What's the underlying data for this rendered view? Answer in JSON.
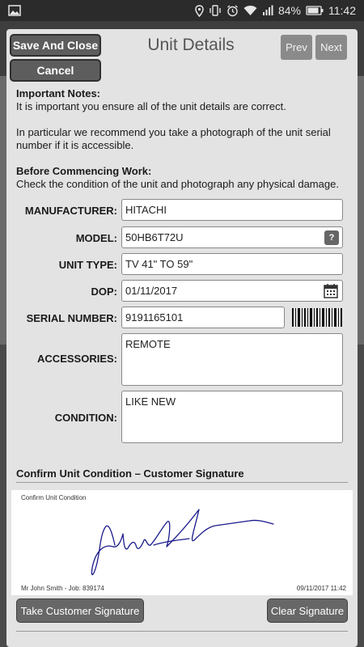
{
  "status_bar": {
    "battery_percent": "84%",
    "time": "11:42",
    "icons": [
      "image-icon",
      "location-icon",
      "vibrate-icon",
      "alarm-icon",
      "wifi-icon",
      "signal-icon",
      "battery-icon"
    ]
  },
  "dialog": {
    "title": "Unit Details",
    "save_close_label": "Save And Close",
    "cancel_label": "Cancel",
    "prev_label": "Prev",
    "next_label": "Next"
  },
  "notes": {
    "important_heading": "Important Notes:",
    "important_line1": "It is important you ensure all of the unit details are correct.",
    "important_line2": "In particular we recommend you take a photograph of the unit serial number if it is accessible.",
    "before_heading": "Before Commencing Work:",
    "before_line": "Check the condition of the unit and photograph any physical damage."
  },
  "form": {
    "manufacturer": {
      "label": "MANUFACTURER:",
      "value": "HITACHI"
    },
    "model": {
      "label": "MODEL:",
      "value": "50HB6T72U",
      "help_label": "?"
    },
    "unit_type": {
      "label": "UNIT TYPE:",
      "value": "TV 41\" TO 59\""
    },
    "dop": {
      "label": "DOP:",
      "value": "01/11/2017"
    },
    "serial_number": {
      "label": "SERIAL NUMBER:",
      "value": "9191165101"
    },
    "accessories": {
      "label": "ACCESSORIES:",
      "value": "REMOTE"
    },
    "condition": {
      "label": "CONDITION:",
      "value": "LIKE NEW"
    }
  },
  "signature": {
    "section_title": "Confirm Unit Condition – Customer Signature",
    "caption": "Confirm Unit Condition",
    "footer_left": "Mr  John Smith - Job: 839174",
    "footer_right": "09/11/2017 11:42",
    "take_label": "Take Customer Signature",
    "clear_label": "Clear Signature"
  },
  "colors": {
    "dialog_bg": "#e3e3e3",
    "button_dark": "#5d5d5d",
    "signature_ink": "#1a1a8c"
  }
}
